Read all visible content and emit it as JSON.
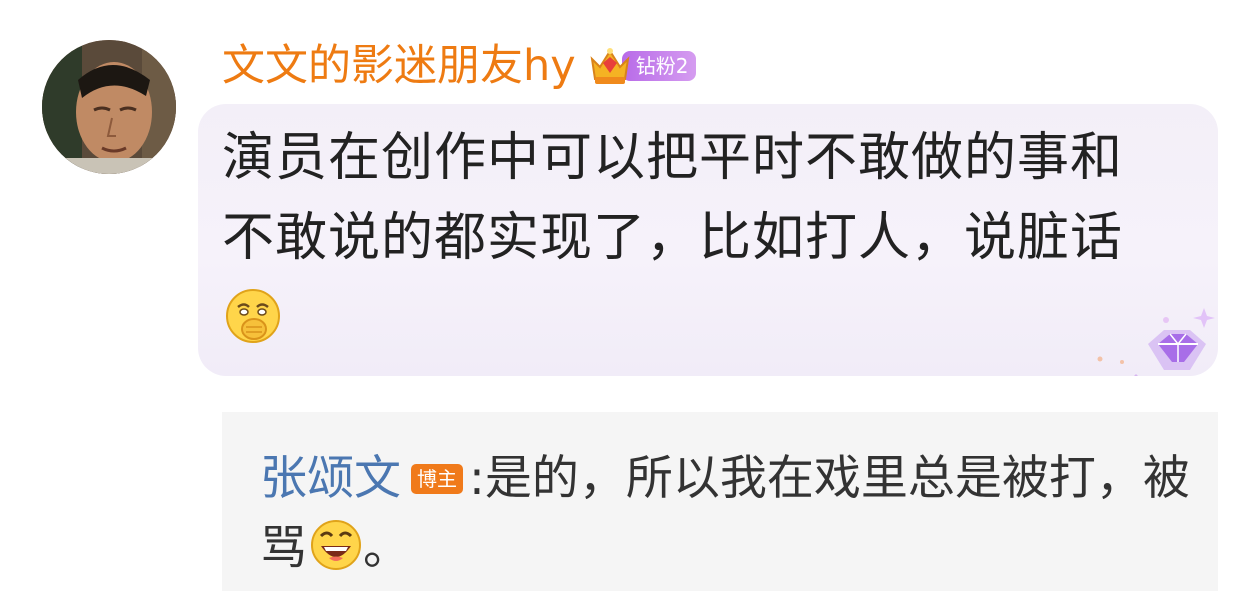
{
  "comment": {
    "username": "文文的影迷朋友hy",
    "fan_badge_label": "钻粉2",
    "text": "演员在创作中可以把平时不敢做的事和不敢说的都实现了，比如打人，说脏话",
    "trailing_emoji": "cover-mouth-giggle-emoji"
  },
  "reply": {
    "author": "张颂文",
    "author_badge": "博主",
    "separator": ":",
    "text": "是的，所以我在戏里总是被打，被骂",
    "emoji": "laughing-emoji",
    "ending": "。"
  },
  "colors": {
    "username": "#ee7b12",
    "reply_author": "#4b77b1",
    "bubble_bg": "#f3eff8",
    "reply_bg": "#f5f5f5",
    "fan_badge": "#b86be8",
    "blogger_badge": "#f07a1a"
  }
}
